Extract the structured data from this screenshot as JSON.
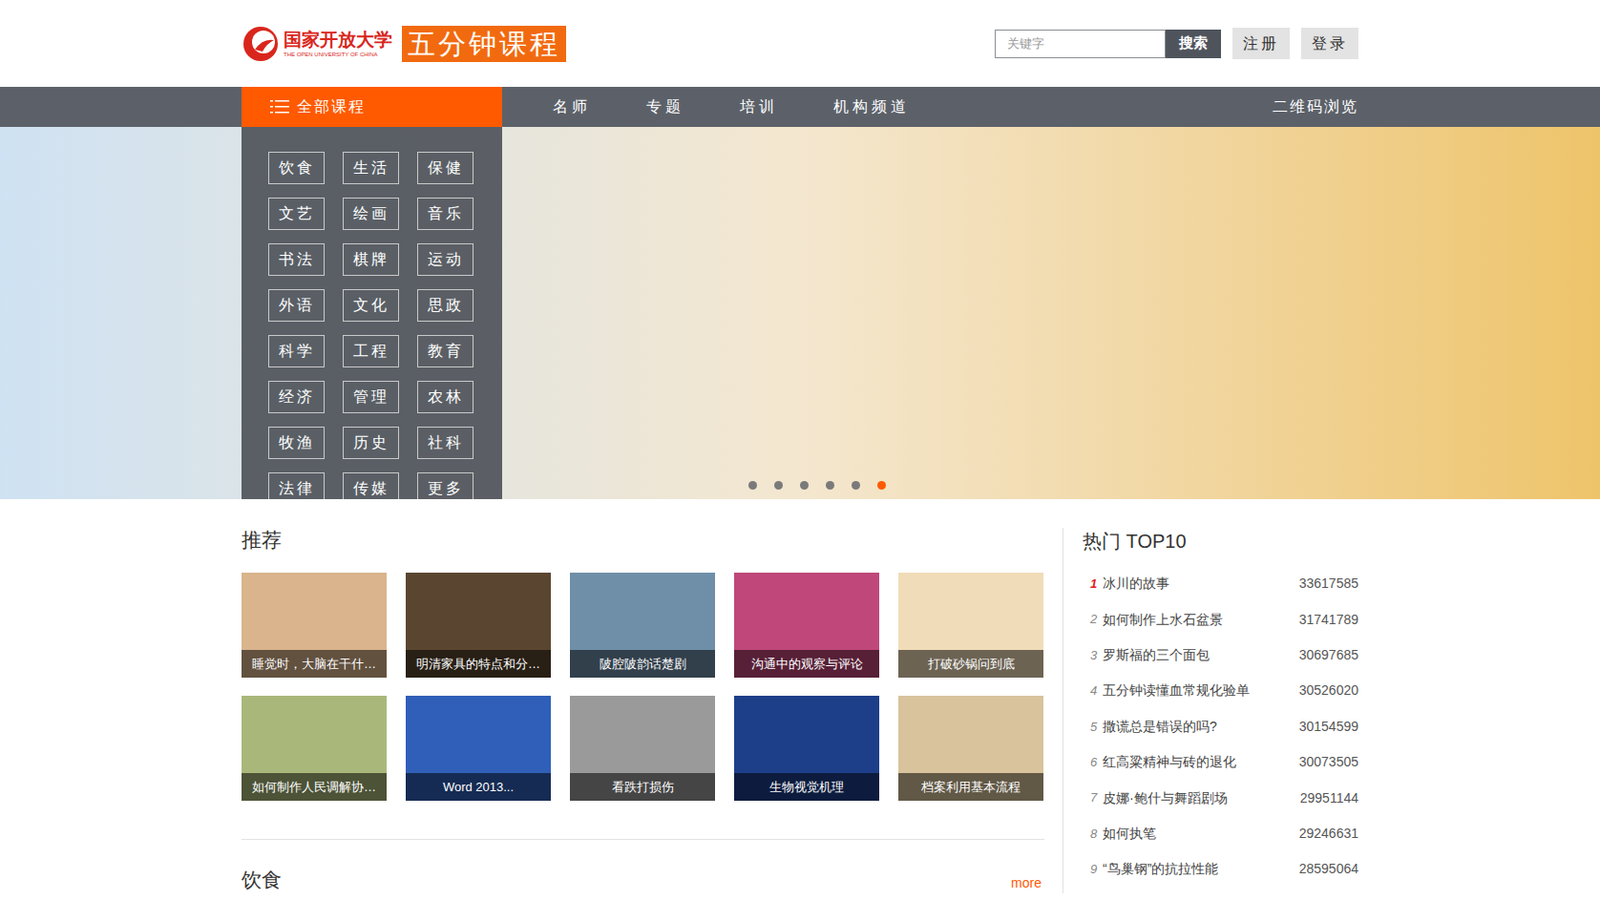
{
  "header": {
    "logo": {
      "name": "国家开放大学",
      "english": "THE OPEN UNIVERSITY OF CHINA",
      "product": "五分钟课程"
    },
    "search": {
      "placeholder": "关键字",
      "button": "搜索"
    },
    "buttons": [
      "注册",
      "登录"
    ]
  },
  "nav": {
    "all": "全部课程",
    "items": [
      "名师",
      "专题",
      "培训",
      "机构频道"
    ],
    "right": "二维码浏览"
  },
  "categories": [
    "饮食",
    "生活",
    "保健",
    "文艺",
    "绘画",
    "音乐",
    "书法",
    "棋牌",
    "运动",
    "外语",
    "文化",
    "思政",
    "科学",
    "工程",
    "教育",
    "经济",
    "管理",
    "农林",
    "牧渔",
    "历史",
    "社科",
    "法律",
    "传媒",
    "更多"
  ],
  "banner": {
    "slides": [
      {
        "selected": false
      },
      {
        "selected": false
      },
      {
        "selected": false
      },
      {
        "selected": false
      },
      {
        "selected": false
      },
      {
        "selected": true
      }
    ]
  },
  "recommend": {
    "title": "推荐",
    "cards": [
      {
        "title": "睡觉时，大脑在干什…",
        "color": "#d9b48c"
      },
      {
        "title": "明清家具的特点和分…",
        "color": "#5a4630"
      },
      {
        "title": "陂腔陂韵话楚剧",
        "color": "#6f8fa8"
      },
      {
        "title": "沟通中的观察与评论",
        "color": "#c0477a"
      },
      {
        "title": "打破砂锅问到底",
        "color": "#f0dcb8"
      },
      {
        "title": "如何制作人民调解协…",
        "color": "#a9b87a"
      },
      {
        "title": "Word 2013...",
        "color": "#2f5fb8"
      },
      {
        "title": "看跌打损伤",
        "color": "#9a9a9a"
      },
      {
        "title": "生物视觉机理",
        "color": "#1d3f8a"
      },
      {
        "title": "档案利用基本流程",
        "color": "#d8c39c"
      }
    ]
  },
  "hot": {
    "title": "热门 TOP10",
    "items": [
      {
        "rank": "1",
        "title": "冰川的故事",
        "count": "33617585",
        "top": true
      },
      {
        "rank": "2",
        "title": "如何制作上水石盆景",
        "count": "31741789",
        "top": false
      },
      {
        "rank": "3",
        "title": "罗斯福的三个面包",
        "count": "30697685",
        "top": false
      },
      {
        "rank": "4",
        "title": "五分钟读懂血常规化验单",
        "count": "30526020",
        "top": false
      },
      {
        "rank": "5",
        "title": "撒谎总是错误的吗?",
        "count": "30154599",
        "top": false
      },
      {
        "rank": "6",
        "title": "红高粱精神与砖的退化",
        "count": "30073505",
        "top": false
      },
      {
        "rank": "7",
        "title": "皮娜·鲍什与舞蹈剧场",
        "count": "29951144",
        "top": false
      },
      {
        "rank": "8",
        "title": "如何执笔",
        "count": "29246631",
        "top": false
      },
      {
        "rank": "9",
        "title": "“鸟巢钢”的抗拉性能",
        "count": "28595064",
        "top": false
      }
    ]
  },
  "section": {
    "title": "饮食",
    "more": "more"
  }
}
